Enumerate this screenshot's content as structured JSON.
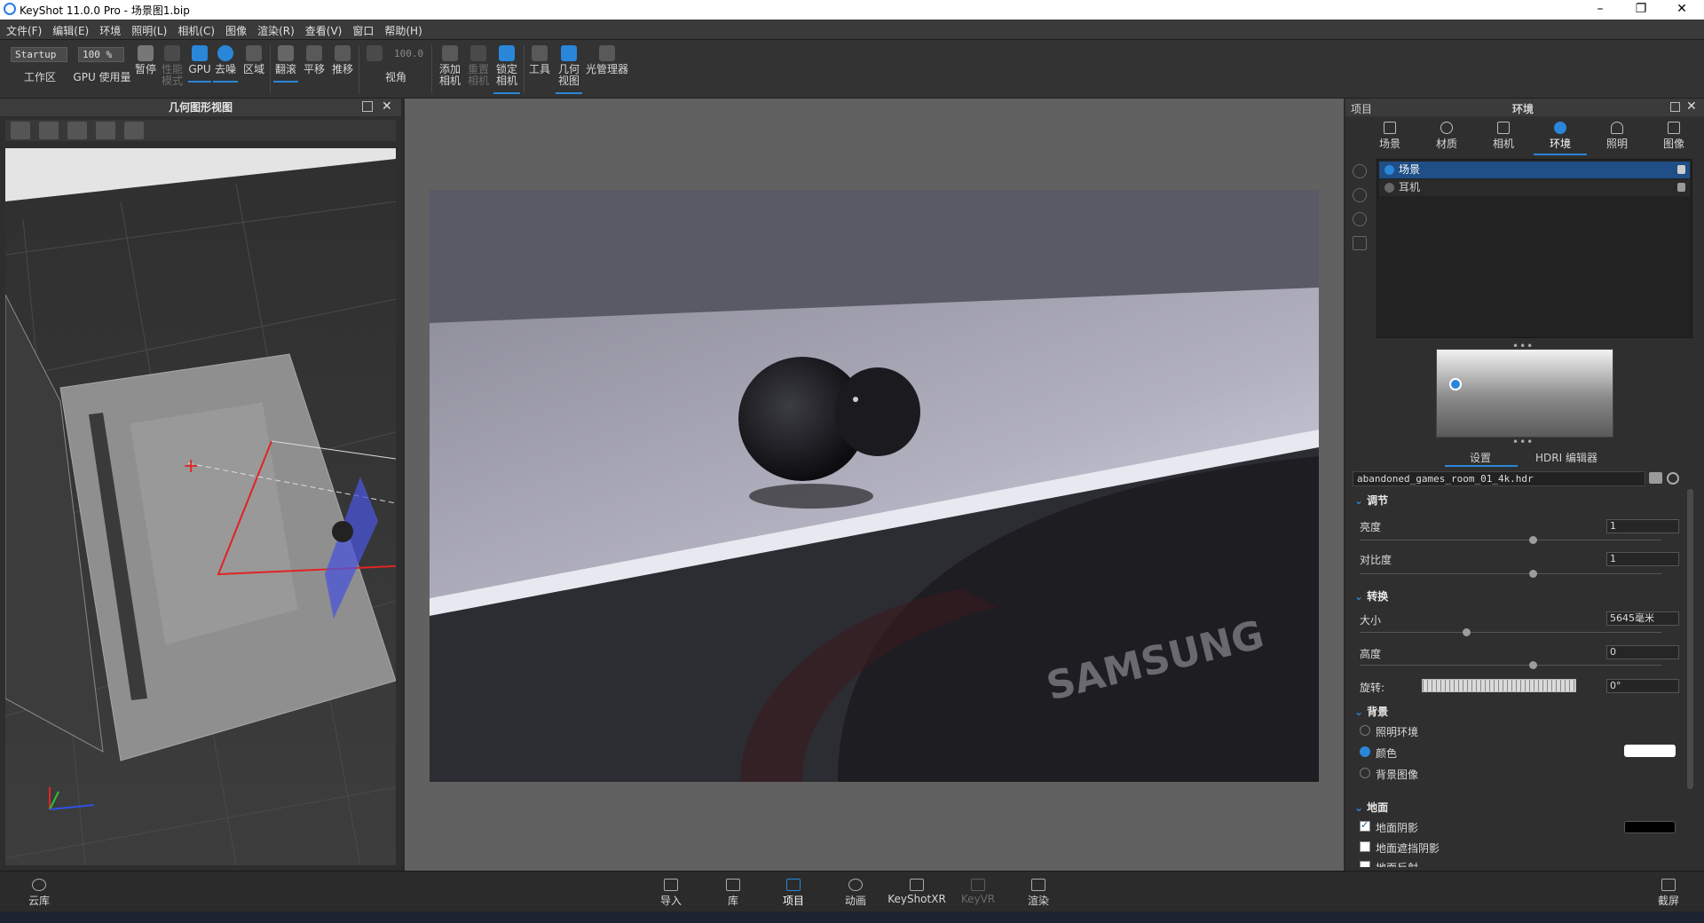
{
  "window": {
    "title": "KeyShot 11.0.0 Pro  - 场景图1.bip",
    "min": "–",
    "max": "❐",
    "close": "✕"
  },
  "menu": [
    "文件(F)",
    "编辑(E)",
    "环境",
    "照明(L)",
    "相机(C)",
    "图像",
    "渲染(R)",
    "查看(V)",
    "窗口",
    "帮助(H)"
  ],
  "toolbar": {
    "workspace_value": "Startup",
    "workspace_label": "工作区",
    "percent_value": "100 %",
    "gpu_usage_label": "GPU 使用量",
    "pause": "暂停",
    "perf_mode": "性能模式",
    "gpu": "GPU",
    "denoise": "去噪",
    "region": "区域",
    "tumble": "翻滚",
    "pan": "平移",
    "dolly": "推移",
    "fov_value": "100.0",
    "fov": "视角",
    "add_camera": [
      "添加",
      "相机"
    ],
    "reset_camera": [
      "重置",
      "相机"
    ],
    "lock_camera": [
      "锁定",
      "相机"
    ],
    "tools": "工具",
    "geometry_view": [
      "几何",
      "视图"
    ],
    "light_manager": "光管理器"
  },
  "geo_panel": {
    "title": "几何图形视图"
  },
  "right_panel": {
    "header_left": "项目",
    "header_title": "环境",
    "tabs": [
      "场景",
      "材质",
      "相机",
      "环境",
      "照明",
      "图像"
    ],
    "active_tab": "环境",
    "env_list": [
      {
        "name": "场景",
        "selected": true
      },
      {
        "name": "耳机",
        "selected": false
      }
    ],
    "subtabs": [
      "设置",
      "HDRI 编辑器"
    ],
    "hdr_file": "abandoned_games_room_01_4k.hdr",
    "sections": {
      "adjust": "调节",
      "brightness_label": "亮度",
      "brightness_value": "1",
      "contrast_label": "对比度",
      "contrast_value": "1",
      "transform": "转换",
      "size_label": "大小",
      "size_value": "5645毫米",
      "height_label": "高度",
      "height_value": "0",
      "rotation_label": "旋转:",
      "rotation_value": "0°",
      "background": "背景",
      "bg_lighting": "照明环境",
      "bg_color": "颜色",
      "bg_image": "背景图像",
      "ground": "地面",
      "ground_shadow": "地面阴影",
      "ground_occlusion": "地面遮挡阴影",
      "ground_reflection": "地面反射"
    },
    "bg_color_value": "#ffffff",
    "shadow_color_value": "#000000"
  },
  "bottom": {
    "cloud": "云库",
    "items": [
      "导入",
      "库",
      "项目",
      "动画",
      "KeyShotXR",
      "KeyVR",
      "渲染"
    ],
    "active": "项目",
    "screenshot": "截屏"
  },
  "colors": {
    "accent": "#2a86d8",
    "panel": "#2f2f2f",
    "viewport": "#616161"
  }
}
